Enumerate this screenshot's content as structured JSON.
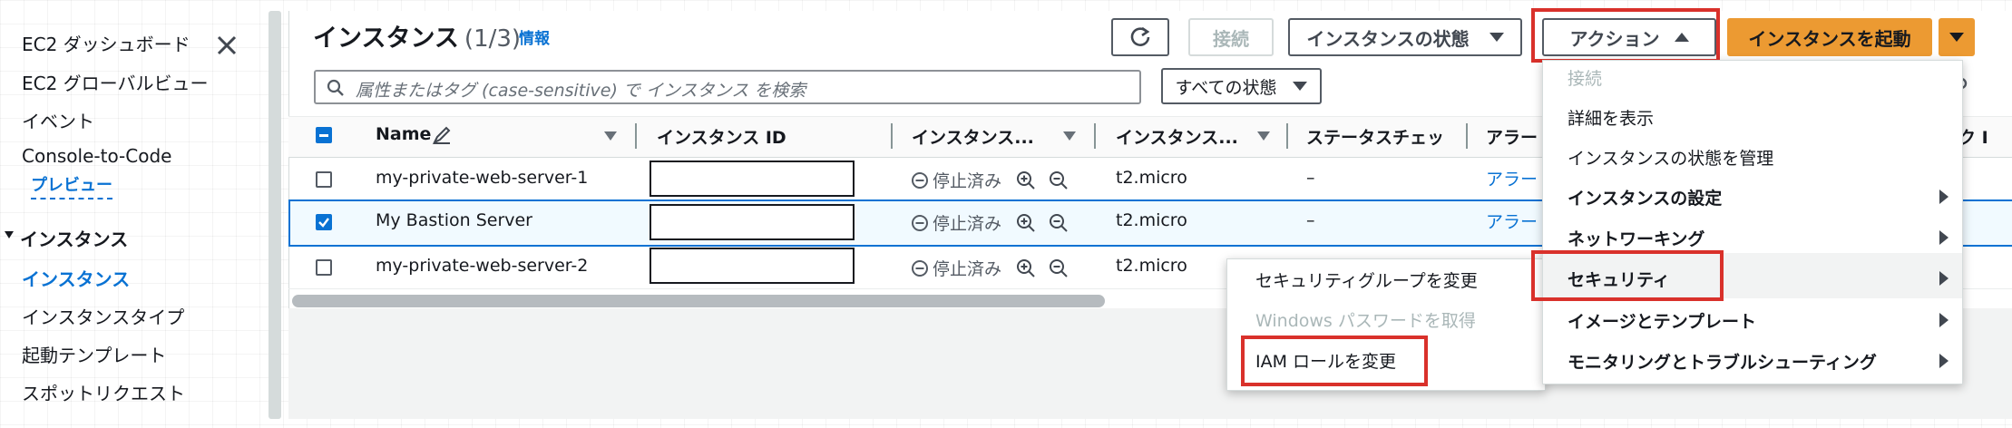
{
  "sidebar": {
    "items_top": [
      "EC2 ダッシュボード",
      "EC2 グローバルビュー",
      "イベント",
      "Console-to-Code"
    ],
    "preview_label": "プレビュー",
    "section_title": "インスタンス",
    "items_section": [
      "インスタンス",
      "インスタンスタイプ",
      "起動テンプレート",
      "スポットリクエスト"
    ],
    "active_item": "インスタンス"
  },
  "header": {
    "title": "インスタンス",
    "count": "(1/3)",
    "info_label": "情報"
  },
  "toolbar": {
    "connect_label": "接続",
    "instance_state_label": "インスタンスの状態",
    "actions_label": "アクション",
    "launch_label": "インスタンスを起動"
  },
  "search": {
    "placeholder": "属性またはタグ (case-sensitive) で インスタンス を検索",
    "state_filter": "すべての状態"
  },
  "table": {
    "columns": {
      "name": "Name",
      "instance_id": "インスタンス ID",
      "instance_state": "インスタンス...",
      "instance_type": "インスタンス...",
      "status_check": "ステータスチェッ",
      "alarm": "アラー",
      "az_partial": "ック I"
    },
    "rows": [
      {
        "name": "my-private-web-server-1",
        "state": "停止済み",
        "type": "t2.micro",
        "status": "–",
        "alarm": "アラー",
        "selected": false
      },
      {
        "name": "My Bastion Server",
        "state": "停止済み",
        "type": "t2.micro",
        "status": "–",
        "alarm": "アラー",
        "selected": true
      },
      {
        "name": "my-private-web-server-2",
        "state": "停止済み",
        "type": "t2.micro",
        "status": "–",
        "alarm": "",
        "selected": false
      }
    ]
  },
  "actions_menu": {
    "items": [
      {
        "label": "接続",
        "disabled": true
      },
      {
        "label": "詳細を表示"
      },
      {
        "label": "インスタンスの状態を管理"
      },
      {
        "label": "インスタンスの設定",
        "submenu": true
      },
      {
        "label": "ネットワーキング",
        "submenu": true
      },
      {
        "label": "セキュリティ",
        "submenu": true
      },
      {
        "label": "イメージとテンプレート",
        "submenu": true
      },
      {
        "label": "モニタリングとトラブルシューティング",
        "submenu": true
      }
    ]
  },
  "security_submenu": {
    "items": [
      {
        "label": "セキュリティグループを変更"
      },
      {
        "label": "Windows パスワードを取得",
        "disabled": true
      },
      {
        "label": "IAM ロールを変更"
      }
    ]
  },
  "colors": {
    "accent": "#0972d3",
    "primary_button": "#ec9a32",
    "highlight_box": "#d9312b"
  }
}
